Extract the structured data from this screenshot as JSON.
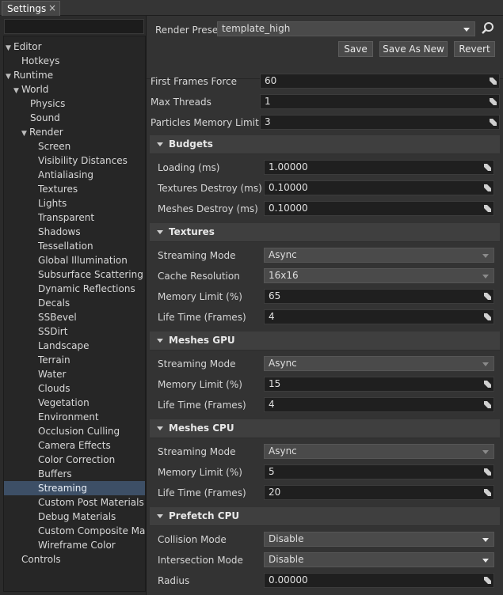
{
  "tab": {
    "title": "Settings",
    "close": "×"
  },
  "tree": {
    "items": [
      {
        "label": "Editor",
        "arrow": "▼"
      },
      {
        "label": "Hotkeys",
        "arrow": ""
      },
      {
        "label": "Runtime",
        "arrow": "▼"
      },
      {
        "label": "World",
        "arrow": "▼"
      },
      {
        "label": "Physics",
        "arrow": ""
      },
      {
        "label": "Sound",
        "arrow": ""
      },
      {
        "label": "Render",
        "arrow": "▼"
      },
      {
        "label": "Screen",
        "arrow": ""
      },
      {
        "label": "Visibility Distances",
        "arrow": ""
      },
      {
        "label": "Antialiasing",
        "arrow": ""
      },
      {
        "label": "Textures",
        "arrow": ""
      },
      {
        "label": "Lights",
        "arrow": ""
      },
      {
        "label": "Transparent",
        "arrow": ""
      },
      {
        "label": "Shadows",
        "arrow": ""
      },
      {
        "label": "Tessellation",
        "arrow": ""
      },
      {
        "label": "Global Illumination",
        "arrow": ""
      },
      {
        "label": "Subsurface Scattering",
        "arrow": ""
      },
      {
        "label": "Dynamic Reflections",
        "arrow": ""
      },
      {
        "label": "Decals",
        "arrow": ""
      },
      {
        "label": "SSBevel",
        "arrow": ""
      },
      {
        "label": "SSDirt",
        "arrow": ""
      },
      {
        "label": "Landscape",
        "arrow": ""
      },
      {
        "label": "Terrain",
        "arrow": ""
      },
      {
        "label": "Water",
        "arrow": ""
      },
      {
        "label": "Clouds",
        "arrow": ""
      },
      {
        "label": "Vegetation",
        "arrow": ""
      },
      {
        "label": "Environment",
        "arrow": ""
      },
      {
        "label": "Occlusion Culling",
        "arrow": ""
      },
      {
        "label": "Camera Effects",
        "arrow": ""
      },
      {
        "label": "Color Correction",
        "arrow": ""
      },
      {
        "label": "Buffers",
        "arrow": ""
      },
      {
        "label": "Streaming",
        "arrow": ""
      },
      {
        "label": "Custom Post Materials",
        "arrow": ""
      },
      {
        "label": "Debug Materials",
        "arrow": ""
      },
      {
        "label": "Custom Composite Ma...",
        "arrow": ""
      },
      {
        "label": "Wireframe Color",
        "arrow": ""
      },
      {
        "label": "Controls",
        "arrow": ""
      }
    ],
    "selected": "Streaming"
  },
  "preset": {
    "label": "Render Preset:",
    "value": "template_high",
    "save": "Save",
    "save_as_new": "Save As New",
    "revert": "Revert"
  },
  "top_fields": [
    {
      "label": "First Frames Force",
      "value": "60"
    },
    {
      "label": "Max Threads",
      "value": "1"
    },
    {
      "label": "Particles Memory Limit (%)",
      "value": "3"
    }
  ],
  "budgets": {
    "title": "Budgets",
    "fields": [
      {
        "label": "Loading (ms)",
        "value": "1.00000"
      },
      {
        "label": "Textures Destroy (ms)",
        "value": "0.10000"
      },
      {
        "label": "Meshes Destroy (ms)",
        "value": "0.10000"
      }
    ]
  },
  "textures": {
    "title": "Textures",
    "streaming_mode": {
      "label": "Streaming Mode",
      "value": "Async"
    },
    "cache_resolution": {
      "label": "Cache Resolution",
      "value": "16x16"
    },
    "memory_limit": {
      "label": "Memory Limit (%)",
      "value": "65"
    },
    "life_time": {
      "label": "Life Time (Frames)",
      "value": "4"
    }
  },
  "meshes_gpu": {
    "title": "Meshes GPU",
    "streaming_mode": {
      "label": "Streaming Mode",
      "value": "Async"
    },
    "memory_limit": {
      "label": "Memory Limit (%)",
      "value": "15"
    },
    "life_time": {
      "label": "Life Time (Frames)",
      "value": "4"
    }
  },
  "meshes_cpu": {
    "title": "Meshes CPU",
    "streaming_mode": {
      "label": "Streaming Mode",
      "value": "Async"
    },
    "memory_limit": {
      "label": "Memory Limit (%)",
      "value": "5"
    },
    "life_time": {
      "label": "Life Time (Frames)",
      "value": "20"
    }
  },
  "prefetch_cpu": {
    "title": "Prefetch CPU",
    "collision_mode": {
      "label": "Collision Mode",
      "value": "Disable"
    },
    "intersection_mode": {
      "label": "Intersection Mode",
      "value": "Disable"
    },
    "radius": {
      "label": "Radius",
      "value": "0.00000"
    }
  }
}
